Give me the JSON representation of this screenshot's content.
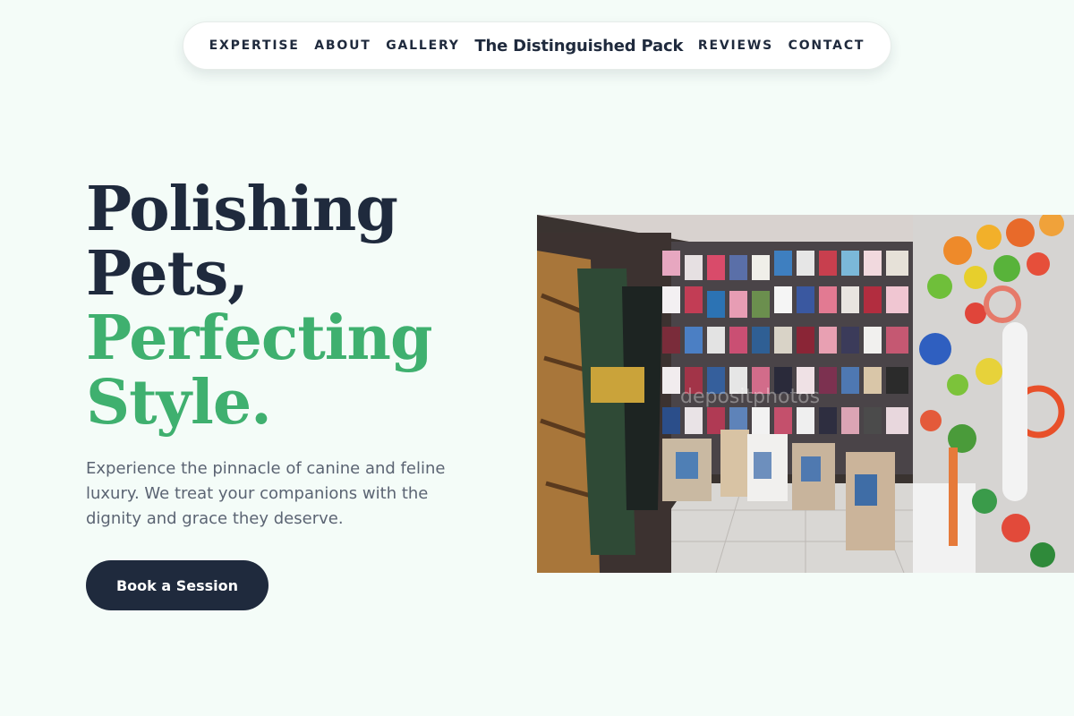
{
  "nav": {
    "links": [
      "EXPERTISE",
      "ABOUT",
      "GALLERY"
    ],
    "brand": "The Distinguished Pack",
    "links_right": [
      "REVIEWS",
      "CONTACT"
    ]
  },
  "hero": {
    "title_line1": "Polishing",
    "title_line2": "Pets,",
    "title_line3": "Perfecting",
    "title_line4": "Style.",
    "subtitle": "Experience the pinnacle of canine and feline luxury. We treat your companions with the dignity and grace they deserve.",
    "cta_label": "Book a Session",
    "image_watermark": "depositphotos"
  },
  "colors": {
    "background": "#f4fcf8",
    "dark": "#1f2a3d",
    "accent_green": "#3fb06f",
    "muted_text": "#5b6473"
  }
}
